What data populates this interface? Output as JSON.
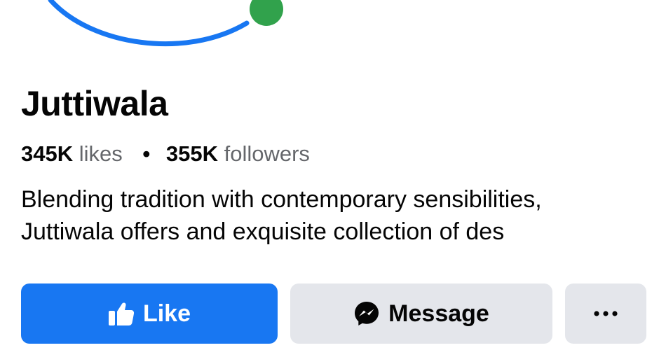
{
  "page": {
    "name": "Juttiwala",
    "stats": {
      "likes_count": "345K",
      "likes_label": "likes",
      "separator": "•",
      "followers_count": "355K",
      "followers_label": "followers"
    },
    "bio_lines": [
      "Blending tradition with contemporary sensibilities,",
      "Juttiwala offers and exquisite collection of des"
    ]
  },
  "actions": {
    "like_label": "Like",
    "message_label": "Message",
    "more_icon": "more-horizontal-icon"
  },
  "colors": {
    "accent_blue": "#1877f2",
    "online_green": "#31a24c",
    "secondary_button_bg": "#e4e6eb",
    "muted_text": "#65676b",
    "primary_text": "#050505"
  }
}
